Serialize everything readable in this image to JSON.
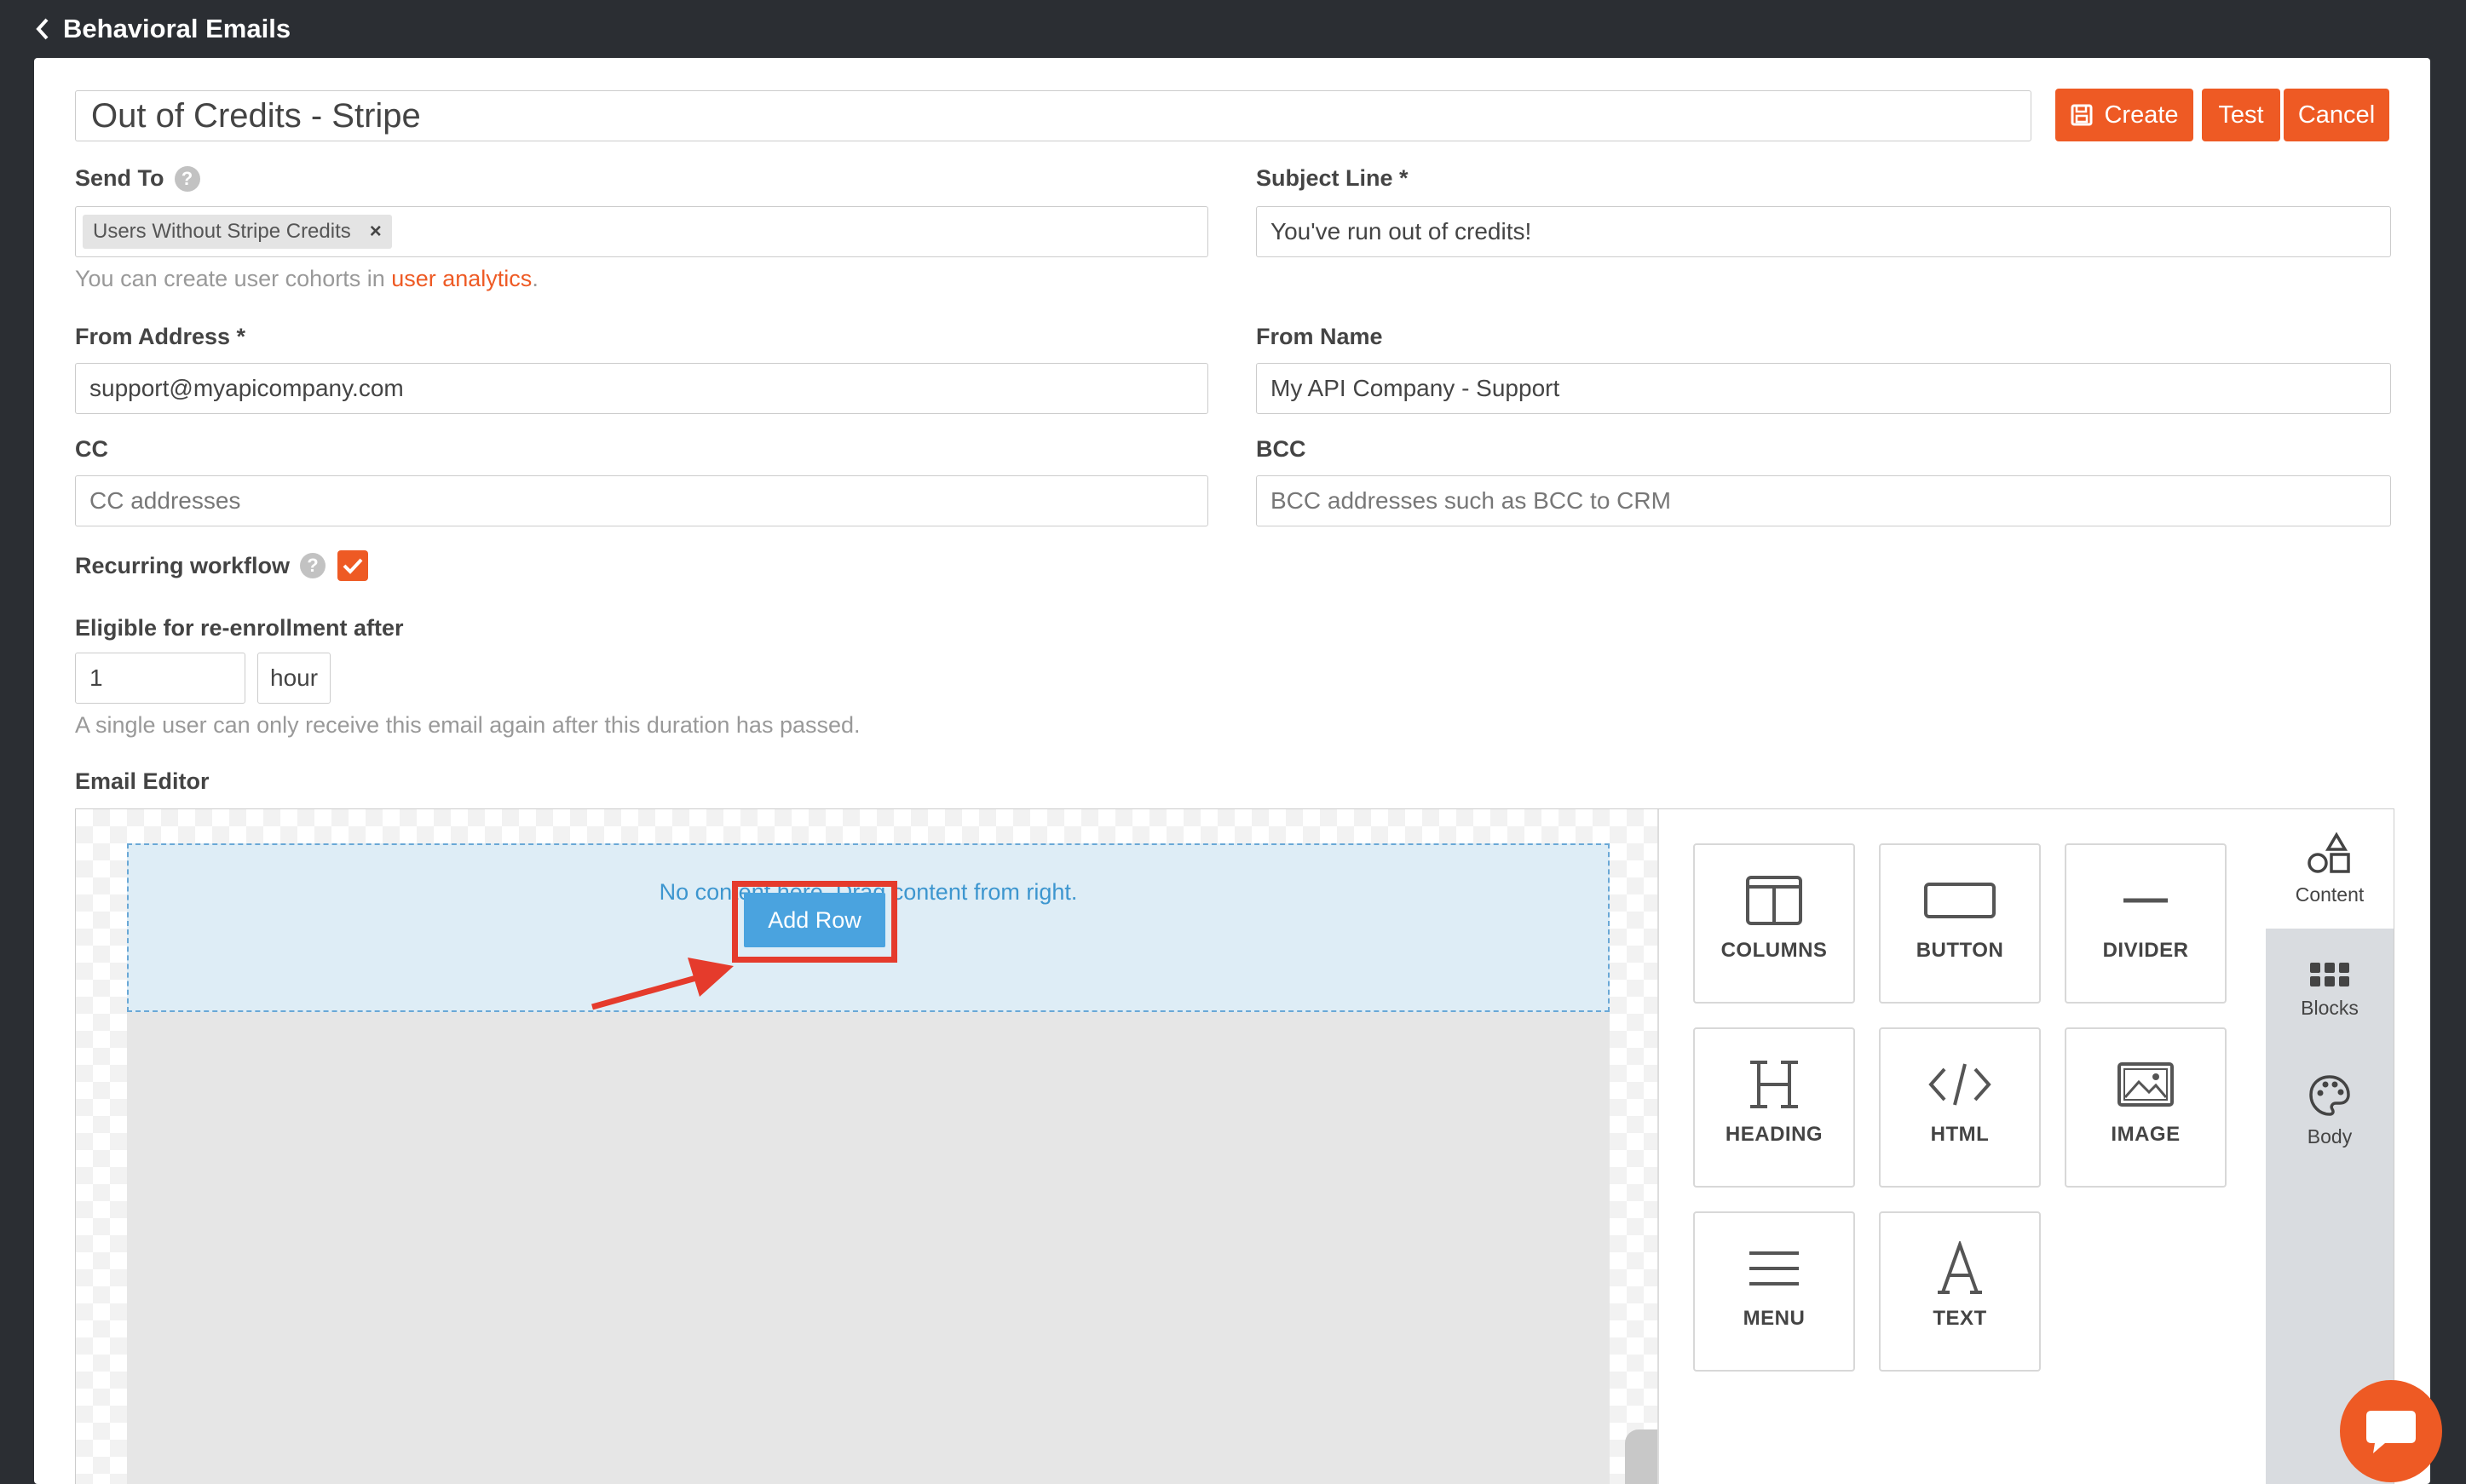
{
  "topbar": {
    "back_icon": "chevron-left-icon",
    "title": "Behavioral Emails"
  },
  "header": {
    "email_name": "Out of Credits - Stripe",
    "create_label": "Create",
    "test_label": "Test",
    "cancel_label": "Cancel",
    "accent_color": "#ee5a24"
  },
  "form": {
    "send_to": {
      "label": "Send To",
      "tag": "Users Without Stripe Credits",
      "tag_remove": "×",
      "hint_prefix": "You can create user cohorts in ",
      "hint_link": "user analytics",
      "hint_suffix": "."
    },
    "subject": {
      "label": "Subject Line *",
      "value": "You've run out of credits!"
    },
    "from_address": {
      "label": "From Address *",
      "value": "support@myapicompany.com"
    },
    "from_name": {
      "label": "From Name",
      "value": "My API Company - Support"
    },
    "cc": {
      "label": "CC",
      "placeholder": "CC addresses"
    },
    "bcc": {
      "label": "BCC",
      "placeholder": "BCC addresses such as BCC to CRM"
    },
    "recurring": {
      "label": "Recurring workflow",
      "checked": true
    },
    "reenroll": {
      "label": "Eligible for re-enrollment after",
      "value": "1",
      "unit": "hour",
      "hint": "A single user can only receive this email again after this duration has passed."
    },
    "help_glyph": "?"
  },
  "editor": {
    "label": "Email Editor",
    "empty_message": "No content here. Drag content from right.",
    "add_row_label": "Add Row",
    "tiles": [
      {
        "label": "COLUMNS",
        "icon": "columns-icon"
      },
      {
        "label": "BUTTON",
        "icon": "button-icon"
      },
      {
        "label": "DIVIDER",
        "icon": "divider-icon"
      },
      {
        "label": "HEADING",
        "icon": "heading-icon"
      },
      {
        "label": "HTML",
        "icon": "code-icon"
      },
      {
        "label": "IMAGE",
        "icon": "image-icon"
      },
      {
        "label": "MENU",
        "icon": "menu-icon"
      },
      {
        "label": "TEXT",
        "icon": "text-icon"
      }
    ],
    "side_tabs": [
      {
        "label": "Content",
        "icon": "shapes-icon",
        "active": true
      },
      {
        "label": "Blocks",
        "icon": "grid-icon",
        "active": false
      },
      {
        "label": "Body",
        "icon": "palette-icon",
        "active": false
      }
    ]
  },
  "chat": {
    "icon": "chat-bubble-icon"
  }
}
